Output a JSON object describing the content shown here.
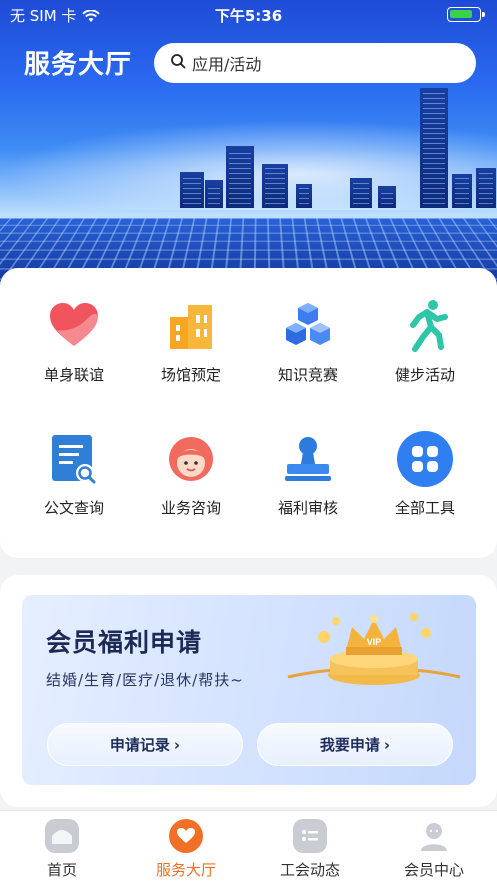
{
  "status_bar": {
    "carrier": "无 SIM 卡",
    "time": "下午5:36",
    "battery_level": 0.8,
    "battery_color": "#38d34b"
  },
  "header": {
    "title": "服务大厅",
    "search_placeholder": "应用/活动"
  },
  "tools": [
    {
      "label": "单身联谊",
      "icon": "heart-icon"
    },
    {
      "label": "场馆预定",
      "icon": "building-icon"
    },
    {
      "label": "知识竞赛",
      "icon": "cubes-icon"
    },
    {
      "label": "健步活动",
      "icon": "runner-icon"
    },
    {
      "label": "公文查询",
      "icon": "document-search-icon"
    },
    {
      "label": "业务咨询",
      "icon": "customer-service-icon"
    },
    {
      "label": "福利审核",
      "icon": "stamp-icon"
    },
    {
      "label": "全部工具",
      "icon": "all-tools-icon"
    }
  ],
  "welfare": {
    "title": "会员福利申请",
    "subtitle": "结婚/生育/医疗/退休/帮扶~",
    "badge": "VIP",
    "buttons": [
      {
        "label": "申请记录"
      },
      {
        "label": "我要申请"
      }
    ]
  },
  "tabbar": {
    "active_color": "#f07028",
    "tabs": [
      {
        "label": "首页",
        "icon": "home-icon"
      },
      {
        "label": "服务大厅",
        "icon": "service-hall-icon"
      },
      {
        "label": "工会动态",
        "icon": "news-icon"
      },
      {
        "label": "会员中心",
        "icon": "member-icon"
      }
    ]
  }
}
